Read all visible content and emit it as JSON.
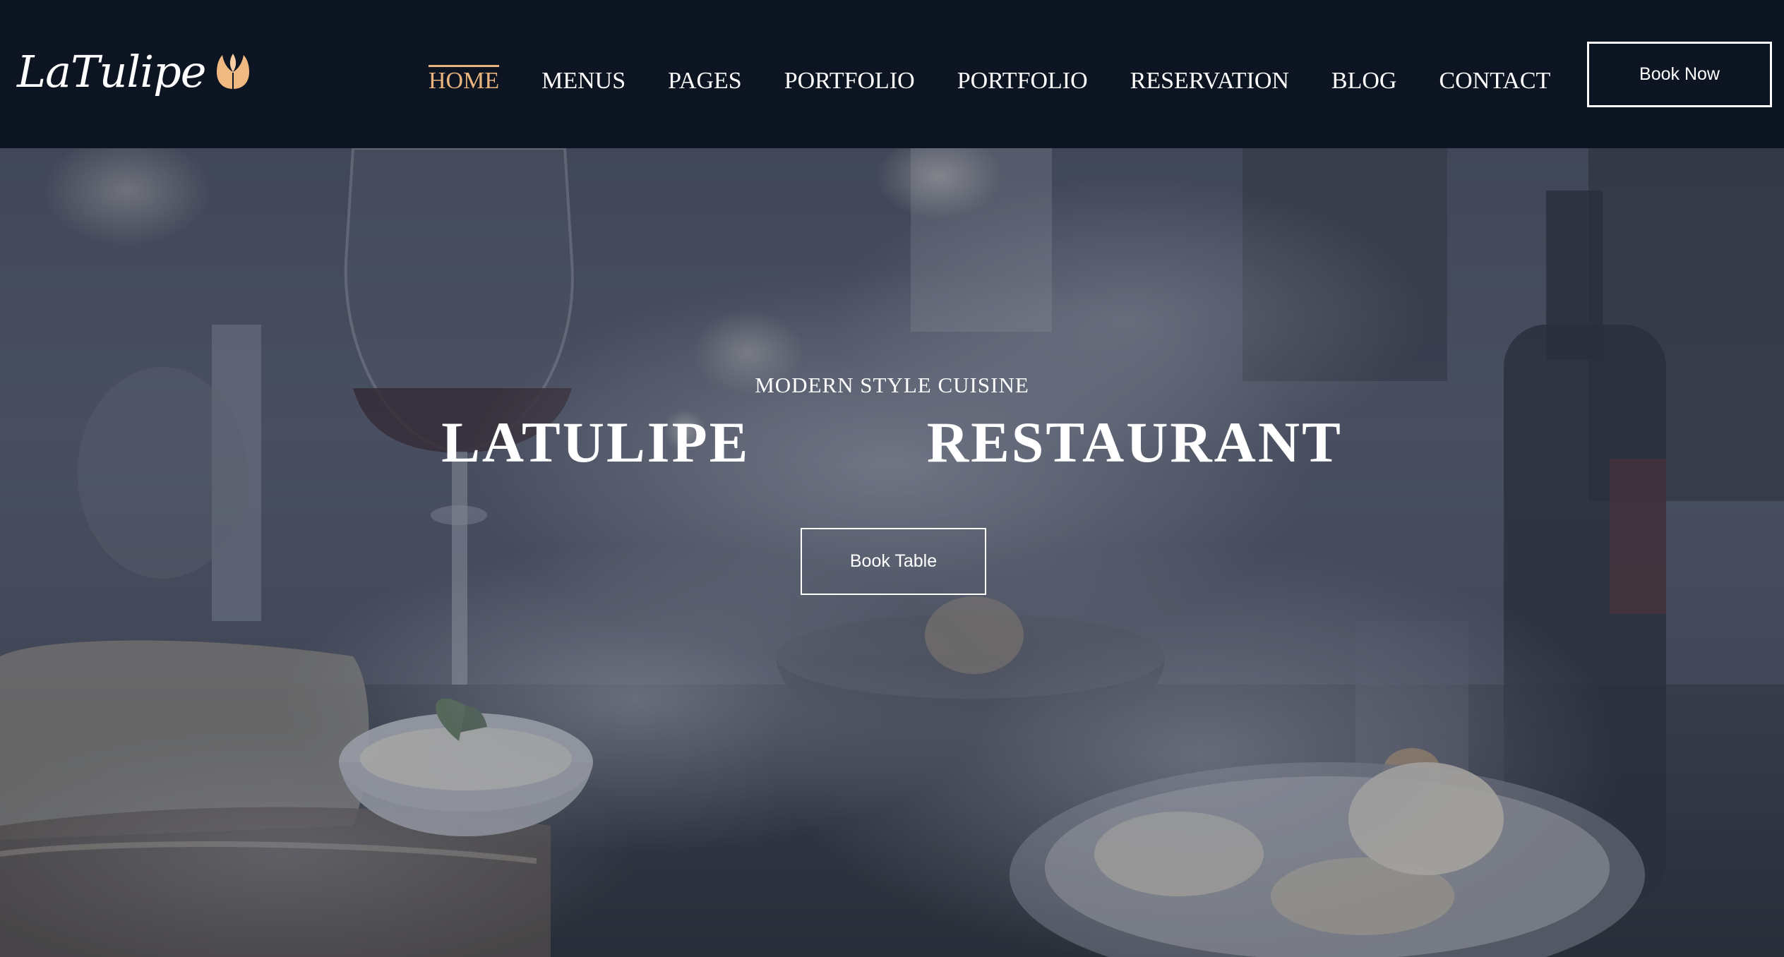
{
  "brand": {
    "name": "LaTulipe",
    "logo_icon": "tulip-icon",
    "accent_color": "#e9b47e",
    "header_bg": "#0d1422"
  },
  "nav": {
    "items": [
      {
        "label": "HOME",
        "active": true
      },
      {
        "label": "MENUS",
        "active": false
      },
      {
        "label": "PAGES",
        "active": false
      },
      {
        "label": "PORTFOLIO",
        "active": false
      },
      {
        "label": "PORTFOLIO",
        "active": false
      },
      {
        "label": "RESERVATION",
        "active": false
      },
      {
        "label": "BLOG",
        "active": false
      },
      {
        "label": "CONTACT",
        "active": false
      }
    ],
    "cta_label": "Book Now"
  },
  "hero": {
    "subtitle": "MODERN STYLE CUISINE",
    "title": "LATULIPE   RESTAURANT",
    "button_label": "Book Table"
  }
}
